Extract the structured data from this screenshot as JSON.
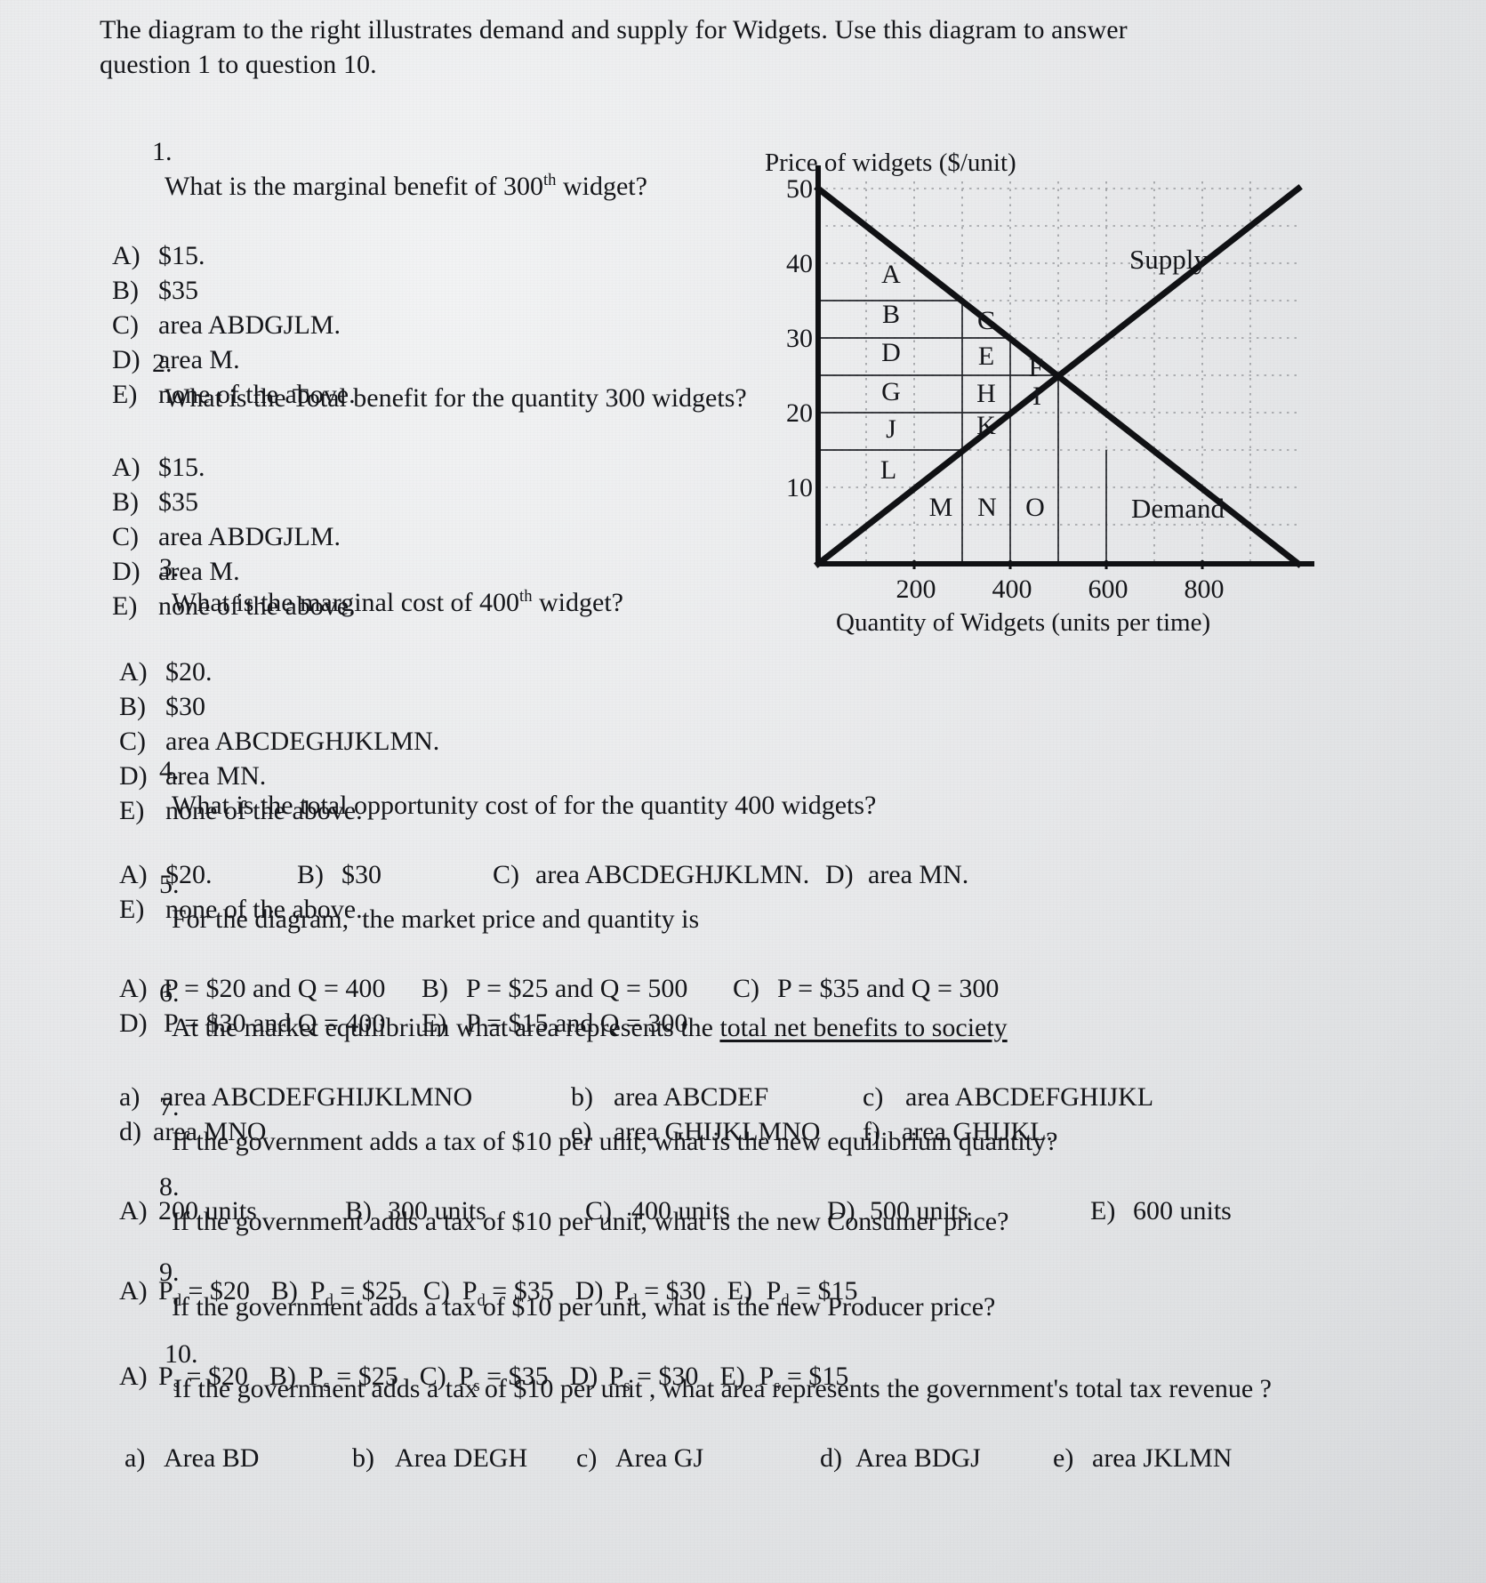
{
  "intro": "The diagram to the right illustrates demand and supply for Widgets. Use this diagram to answer question 1 to question 10.",
  "questions": [
    {
      "number": "1.",
      "text": "What is the marginal benefit of 300th widget?",
      "text_pre": "What is the marginal benefit of 300",
      "sup": "th",
      "text_post": " widget?",
      "options": [
        {
          "label": "A)",
          "text": "$15."
        },
        {
          "label": "B)",
          "text": "$35"
        },
        {
          "label": "C)",
          "text": "area ABDGJLM."
        },
        {
          "label": "D)",
          "text": "area M."
        },
        {
          "label": "E)",
          "text": "none of the above."
        }
      ]
    },
    {
      "number": "2.",
      "text": "What is the Total benefit for the quantity 300 widgets?",
      "options": [
        {
          "label": "A)",
          "text": "$15."
        },
        {
          "label": "B)",
          "text": "$35"
        },
        {
          "label": "C)",
          "text": "area ABDGJLM."
        },
        {
          "label": "D)",
          "text": "area M."
        },
        {
          "label": "E)",
          "text": "none of the above."
        }
      ]
    },
    {
      "number": "3.",
      "text_pre": "What is the marginal cost of 400",
      "sup": "th",
      "text_post": " widget?",
      "options": [
        {
          "label": "A)",
          "text": "$20."
        },
        {
          "label": "B)",
          "text": "$30"
        },
        {
          "label": "C)",
          "text": "area ABCDEGHJKLMN."
        },
        {
          "label": "D)",
          "text": "area MN."
        },
        {
          "label": "E)",
          "text": "none of the above."
        }
      ]
    },
    {
      "number": "4.",
      "text": "What is the total opportunity cost of for the quantity 400 widgets?",
      "row1": [
        {
          "label": "A)",
          "text": "$20."
        },
        {
          "label": "B)",
          "text": "$30"
        },
        {
          "label": "C)",
          "text": "area ABCDEGHJKLMN."
        },
        {
          "label": "D)",
          "text": "area MN."
        }
      ],
      "row2": [
        {
          "label": "E)",
          "text": "none of the above."
        }
      ]
    },
    {
      "number": "5.",
      "text": "For the diagram,  the market price and quantity is",
      "row1": [
        {
          "label": "A)",
          "text": "P = $20 and Q = 400"
        },
        {
          "label": "B)",
          "text": "P = $25 and Q = 500"
        },
        {
          "label": "C)",
          "text": "P = $35 and Q = 300"
        }
      ],
      "row2": [
        {
          "label": "D)",
          "text": "P = $30 and Q = 400"
        },
        {
          "label": "E)",
          "text": "P = $15 and Q = 300"
        }
      ]
    },
    {
      "number": "6.",
      "text_pre": "At the market equilibrium what area represents the ",
      "underlined": "total net benefits to society",
      "row1": [
        {
          "label": "a)",
          "text": "area ABCDEFGHIJKLMNO"
        },
        {
          "label": "b)",
          "text": "area ABCDEF"
        },
        {
          "label": "c)",
          "text": "area ABCDEFGHIJKL"
        }
      ],
      "row2": [
        {
          "label": "d)",
          "text": "area MNO"
        },
        {
          "label": "e)",
          "text": "area GHIJKLMNO"
        },
        {
          "label": "f)",
          "text": "area GHIJKL."
        }
      ]
    },
    {
      "number": "7.",
      "text": "If the government adds a tax of $10 per unit, what is the new equilibrium quantity?",
      "row1": [
        {
          "label": "A)",
          "text": "200 units"
        },
        {
          "label": "B)",
          "text": "300 units"
        },
        {
          "label": "C)",
          "text": "400 units"
        },
        {
          "label": "D)",
          "text": "500 units"
        },
        {
          "label": "E)",
          "text": "600 units"
        }
      ]
    },
    {
      "number": "8.",
      "text": "If the government adds a tax of $10 per unit, what is the new Consumer price?",
      "sub_var": "d",
      "row1": [
        {
          "label": "A)",
          "var": "P",
          "sub": "d",
          "text": " = $20"
        },
        {
          "label": "B)",
          "var": "P",
          "sub": "d",
          "text": " = $25"
        },
        {
          "label": "C)",
          "var": "P",
          "sub": "d",
          "text": " = $35"
        },
        {
          "label": "D)",
          "var": "P",
          "sub": "d",
          "text": " = $30"
        },
        {
          "label": "E)",
          "var": "P",
          "sub": "d",
          "text": " = $15"
        }
      ]
    },
    {
      "number": "9.",
      "text": "If the government adds a tax of $10 per unit, what is the new Producer price?",
      "sub_var": "s",
      "row1": [
        {
          "label": "A)",
          "var": "P",
          "sub": "s",
          "text": " = $20"
        },
        {
          "label": "B)",
          "var": "P",
          "sub": "s",
          "text": " = $25"
        },
        {
          "label": "C)",
          "var": "P",
          "sub": "s",
          "text": " = $35"
        },
        {
          "label": "D)",
          "var": "P",
          "sub": "s",
          "text": " = $30"
        },
        {
          "label": "E)",
          "var": "P",
          "sub": "s",
          "text": " = $15"
        }
      ]
    },
    {
      "number": "10.",
      "text": "If the government adds a tax of $10 per unit , what area represents the government's total tax revenue ?",
      "row1": [
        {
          "label": "a)",
          "text": "Area BD"
        },
        {
          "label": "b)",
          "text": "Area DEGH"
        },
        {
          "label": "c)",
          "text": "Area GJ"
        },
        {
          "label": "d)",
          "text": "Area BDGJ"
        },
        {
          "label": "e)",
          "text": "area JKLMN"
        }
      ]
    }
  ],
  "chart_data": {
    "type": "line",
    "title": "Price of widgets ($/unit)",
    "xlabel": "Quantity of Widgets (units per time)",
    "ylabel": "Price of widgets ($/unit)",
    "xlim": [
      0,
      1000
    ],
    "ylim": [
      0,
      50
    ],
    "xticks": [
      200,
      400,
      600,
      800
    ],
    "yticks": [
      10,
      20,
      30,
      40,
      50
    ],
    "grid": true,
    "grid_style": "dotted",
    "legend_position": "on-curve-ends",
    "series": [
      {
        "name": "Demand",
        "points": [
          [
            0,
            50
          ],
          [
            1000,
            0
          ]
        ],
        "label": "Demand",
        "label_at": [
          820,
          7
        ]
      },
      {
        "name": "Supply",
        "points": [
          [
            0,
            0
          ],
          [
            1000,
            50
          ]
        ],
        "label": "Supply",
        "label_at": [
          820,
          43
        ]
      }
    ],
    "equilibrium": {
      "quantity": 500,
      "price": 25
    },
    "region_labels": [
      {
        "id": "A",
        "x": 150,
        "y": 42.5
      },
      {
        "id": "B",
        "x": 150,
        "y": 32.5
      },
      {
        "id": "C",
        "x": 350,
        "y": 32.5
      },
      {
        "id": "D",
        "x": 150,
        "y": 27.5
      },
      {
        "id": "E",
        "x": 350,
        "y": 27.5
      },
      {
        "id": "F",
        "x": 450,
        "y": 26.5
      },
      {
        "id": "G",
        "x": 150,
        "y": 22.5
      },
      {
        "id": "H",
        "x": 350,
        "y": 22.5
      },
      {
        "id": "I",
        "x": 450,
        "y": 23.0
      },
      {
        "id": "J",
        "x": 150,
        "y": 17.5
      },
      {
        "id": "K",
        "x": 350,
        "y": 18.0
      },
      {
        "id": "L",
        "x": 150,
        "y": 12.0
      },
      {
        "id": "M",
        "x": 350,
        "y": 7.0
      },
      {
        "id": "N",
        "x": 450,
        "y": 7.0
      },
      {
        "id": "O",
        "x": 550,
        "y": 7.0
      }
    ],
    "horizontal_rules": [
      {
        "y": 35,
        "x0": 0,
        "x1": 300
      },
      {
        "y": 30,
        "x0": 0,
        "x1": 400
      },
      {
        "y": 25,
        "x0": 0,
        "x1": 500
      },
      {
        "y": 20,
        "x0": 0,
        "x1": 400
      },
      {
        "y": 15,
        "x0": 0,
        "x1": 300
      }
    ],
    "vertical_rules": [
      {
        "x": 300,
        "y0": 0,
        "y1": 35
      },
      {
        "x": 400,
        "y0": 0,
        "y1": 30
      },
      {
        "x": 500,
        "y0": 0,
        "y1": 25
      },
      {
        "x": 600,
        "y0": 0,
        "y1": 15
      }
    ]
  }
}
